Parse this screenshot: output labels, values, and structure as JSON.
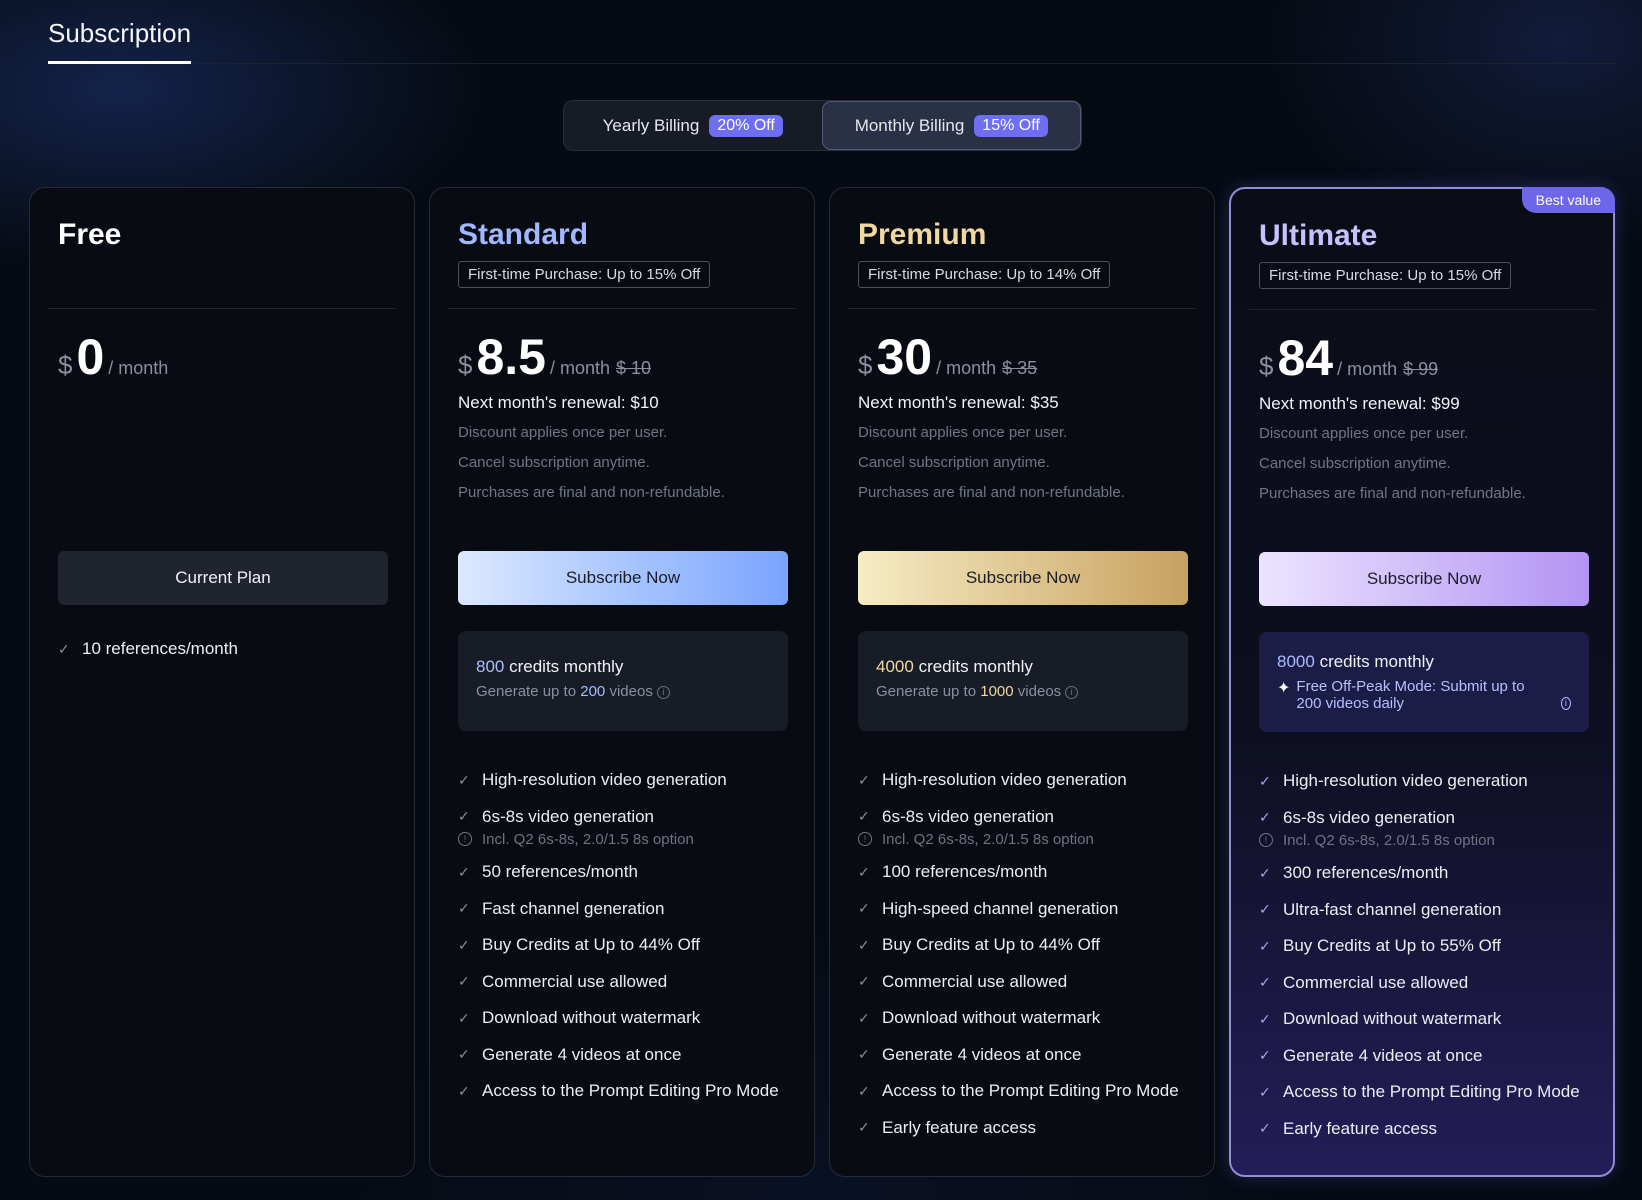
{
  "header": {
    "title": "Subscription"
  },
  "billing": {
    "yearly_label": "Yearly Billing",
    "yearly_badge": "20% Off",
    "monthly_label": "Monthly Billing",
    "monthly_badge": "15% Off",
    "selected": "monthly"
  },
  "plans": [
    {
      "name": "Free",
      "currency": "$",
      "price": "0",
      "per": "/ month",
      "cta": "Current Plan",
      "features": [
        "10 references/month"
      ]
    },
    {
      "name": "Standard",
      "promo": "First-time Purchase: Up to 15% Off",
      "currency": "$",
      "price": "8.5",
      "per": "/ month",
      "original": "$ 10",
      "renewal": "Next month's renewal: $10",
      "notes": [
        "Discount applies once per user.",
        "Cancel subscription anytime.",
        "Purchases are final and non-refundable."
      ],
      "cta": "Subscribe Now",
      "credits_num": "800",
      "credits_text": "credits monthly",
      "videos_prefix": "Generate up to",
      "videos_num": "200",
      "videos_suffix": "videos",
      "features": [
        "High-resolution video generation",
        "6s-8s video generation",
        "50 references/month",
        "Fast channel generation",
        "Buy Credits at Up to 44% Off",
        "Commercial use allowed",
        "Download without watermark",
        "Generate 4 videos at once",
        "Access to the Prompt Editing Pro Mode"
      ],
      "subnote": "Incl. Q2 6s-8s, 2.0/1.5 8s option"
    },
    {
      "name": "Premium",
      "promo": "First-time Purchase: Up to 14% Off",
      "currency": "$",
      "price": "30",
      "per": "/ month",
      "original": "$ 35",
      "renewal": "Next month's renewal: $35",
      "notes": [
        "Discount applies once per user.",
        "Cancel subscription anytime.",
        "Purchases are final and non-refundable."
      ],
      "cta": "Subscribe Now",
      "credits_num": "4000",
      "credits_text": "credits monthly",
      "videos_prefix": "Generate up to",
      "videos_num": "1000",
      "videos_suffix": "videos",
      "features": [
        "High-resolution video generation",
        "6s-8s video generation",
        "100 references/month",
        "High-speed channel generation",
        "Buy Credits at Up to 44% Off",
        "Commercial use allowed",
        "Download without watermark",
        "Generate 4 videos at once",
        "Access to the Prompt Editing Pro Mode",
        "Early feature access"
      ],
      "subnote": "Incl. Q2 6s-8s, 2.0/1.5 8s option"
    },
    {
      "name": "Ultimate",
      "badge": "Best value",
      "promo": "First-time Purchase: Up to 15% Off",
      "currency": "$",
      "price": "84",
      "per": "/ month",
      "original": "$ 99",
      "renewal": "Next month's renewal: $99",
      "notes": [
        "Discount applies once per user.",
        "Cancel subscription anytime.",
        "Purchases are final and non-refundable."
      ],
      "cta": "Subscribe Now",
      "credits_num": "8000",
      "credits_text": "credits monthly",
      "offpeak": "Free Off-Peak Mode: Submit up to 200 videos daily",
      "features": [
        "High-resolution video generation",
        "6s-8s video generation",
        "300 references/month",
        "Ultra-fast channel generation",
        "Buy Credits at Up to 55% Off",
        "Commercial use allowed",
        "Download without watermark",
        "Generate 4 videos at once",
        "Access to the Prompt Editing Pro Mode",
        "Early feature access"
      ],
      "subnote": "Incl. Q2 6s-8s, 2.0/1.5 8s option"
    }
  ],
  "icons": {
    "check": "check-icon",
    "info": "info-icon",
    "sparkle": "sparkle-icon"
  }
}
